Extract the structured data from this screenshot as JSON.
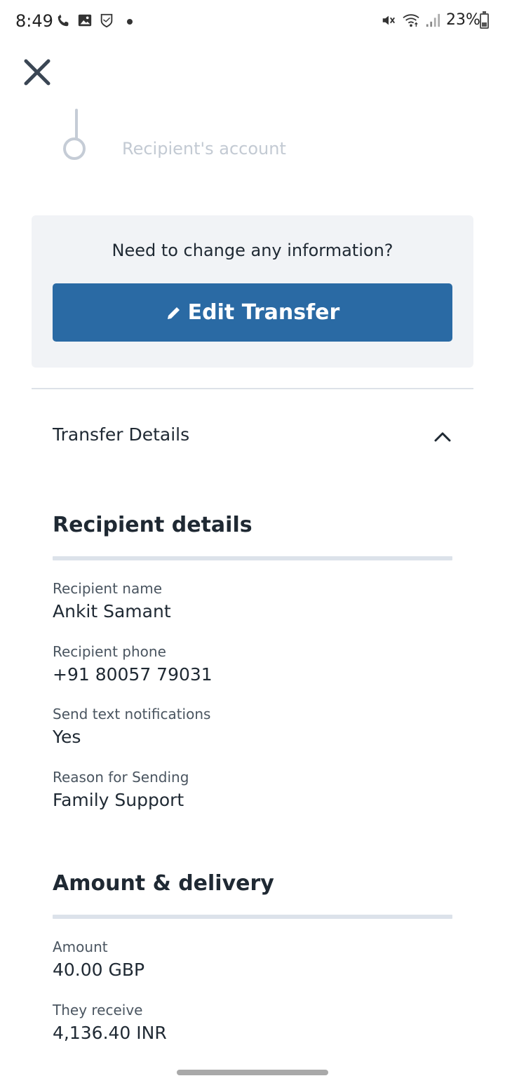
{
  "status_bar": {
    "time": "8:49",
    "battery_percent": "23%",
    "icons": [
      "phone-icon",
      "image-icon",
      "shield-icon",
      "mute-icon",
      "wifi-icon",
      "signal-icon",
      "battery-icon"
    ]
  },
  "progress": {
    "step_label": "Recipient's account"
  },
  "change_box": {
    "question": "Need to change any information?",
    "edit_button_label": "Edit Transfer"
  },
  "transfer_details": {
    "header_label": "Transfer Details",
    "expanded": true
  },
  "recipient_section": {
    "title": "Recipient details",
    "fields": [
      {
        "label": "Recipient name",
        "value": "Ankit Samant"
      },
      {
        "label": "Recipient phone",
        "value": "+91 80057 79031"
      },
      {
        "label": "Send text notifications",
        "value": "Yes"
      },
      {
        "label": "Reason for Sending",
        "value": "Family Support"
      }
    ]
  },
  "amount_section": {
    "title": "Amount & delivery",
    "fields": [
      {
        "label": "Amount",
        "value": "40.00 GBP"
      },
      {
        "label": "They receive",
        "value": "4,136.40 INR"
      }
    ]
  },
  "colors": {
    "primary_button": "#2a6aa4",
    "panel_bg": "#f1f3f6",
    "muted_step": "#c5ccd6",
    "section_rule": "#dce2ea"
  }
}
